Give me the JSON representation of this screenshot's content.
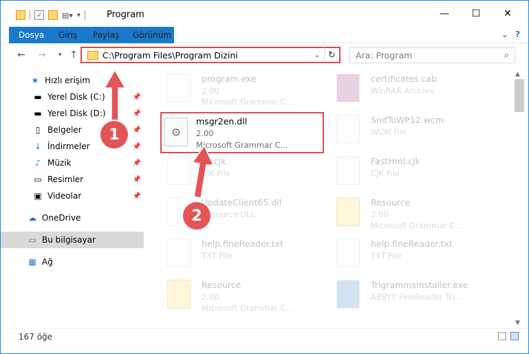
{
  "window": {
    "title": "Program",
    "minimize": "—",
    "maximize": "☐",
    "close": "✕"
  },
  "ribbon": {
    "tabs": [
      "Dosya",
      "Giriş",
      "Paylaş",
      "Görünüm"
    ],
    "help": "?"
  },
  "nav": {
    "address": "C:\\Program Files\\Program Dizini",
    "search_placeholder": "Ara: Program"
  },
  "sidebar": {
    "items": [
      {
        "label": "Hızlı erişim",
        "icon": "star-icon"
      },
      {
        "label": "Yerel Disk (C:)",
        "icon": "drive-icon"
      },
      {
        "label": "Yerel Disk (D:)",
        "icon": "drive-icon"
      },
      {
        "label": "Belgeler",
        "icon": "documents-icon"
      },
      {
        "label": "İndirmeler",
        "icon": "download-icon"
      },
      {
        "label": "Müzik",
        "icon": "music-icon"
      },
      {
        "label": "Resimler",
        "icon": "pictures-icon"
      },
      {
        "label": "Videolar",
        "icon": "videos-icon"
      },
      {
        "label": "OneDrive",
        "icon": "cloud-icon"
      },
      {
        "label": "Bu bilgisayar",
        "icon": "computer-icon"
      },
      {
        "label": "Ağ",
        "icon": "network-icon"
      }
    ]
  },
  "files": [
    {
      "name": "program.exe",
      "l2": "2.00",
      "l3": "Microsoft Grammar C..."
    },
    {
      "name": "certificates.cab",
      "l2": "WinRAR Archive",
      "l3": ""
    },
    {
      "name": "msgr2en.dll",
      "l2": "2.00",
      "l3": "Microsoft Grammar C..."
    },
    {
      "name": "SndToWP12.wcm",
      "l2": "WCM File",
      "l3": ""
    },
    {
      "name": "sk.cjk",
      "l2": "CJK File",
      "l3": ""
    },
    {
      "name": "FastHml.cjk",
      "l2": "CJK File",
      "l3": ""
    },
    {
      "name": "UpdateClient65.dll",
      "l2": "Resource DLL",
      "l3": ""
    },
    {
      "name": "Resource",
      "l2": "2.00",
      "l3": "Microsoft Grammar C..."
    },
    {
      "name": "help.fineReader.txt",
      "l2": "TXT File",
      "l3": ""
    },
    {
      "name": "help.fineReader.txt",
      "l2": "TXT File",
      "l3": ""
    },
    {
      "name": "Resource",
      "l2": "2.00",
      "l3": "Microsoft Grammar C..."
    },
    {
      "name": "TrigrammsInstaller.exe",
      "l2": "ABBYY FineReader Tri...",
      "l3": ""
    }
  ],
  "status": {
    "count": "167 öğe"
  },
  "markers": [
    "1",
    "2"
  ],
  "colors": {
    "accent": "#1979ca",
    "highlight": "#e04848"
  }
}
